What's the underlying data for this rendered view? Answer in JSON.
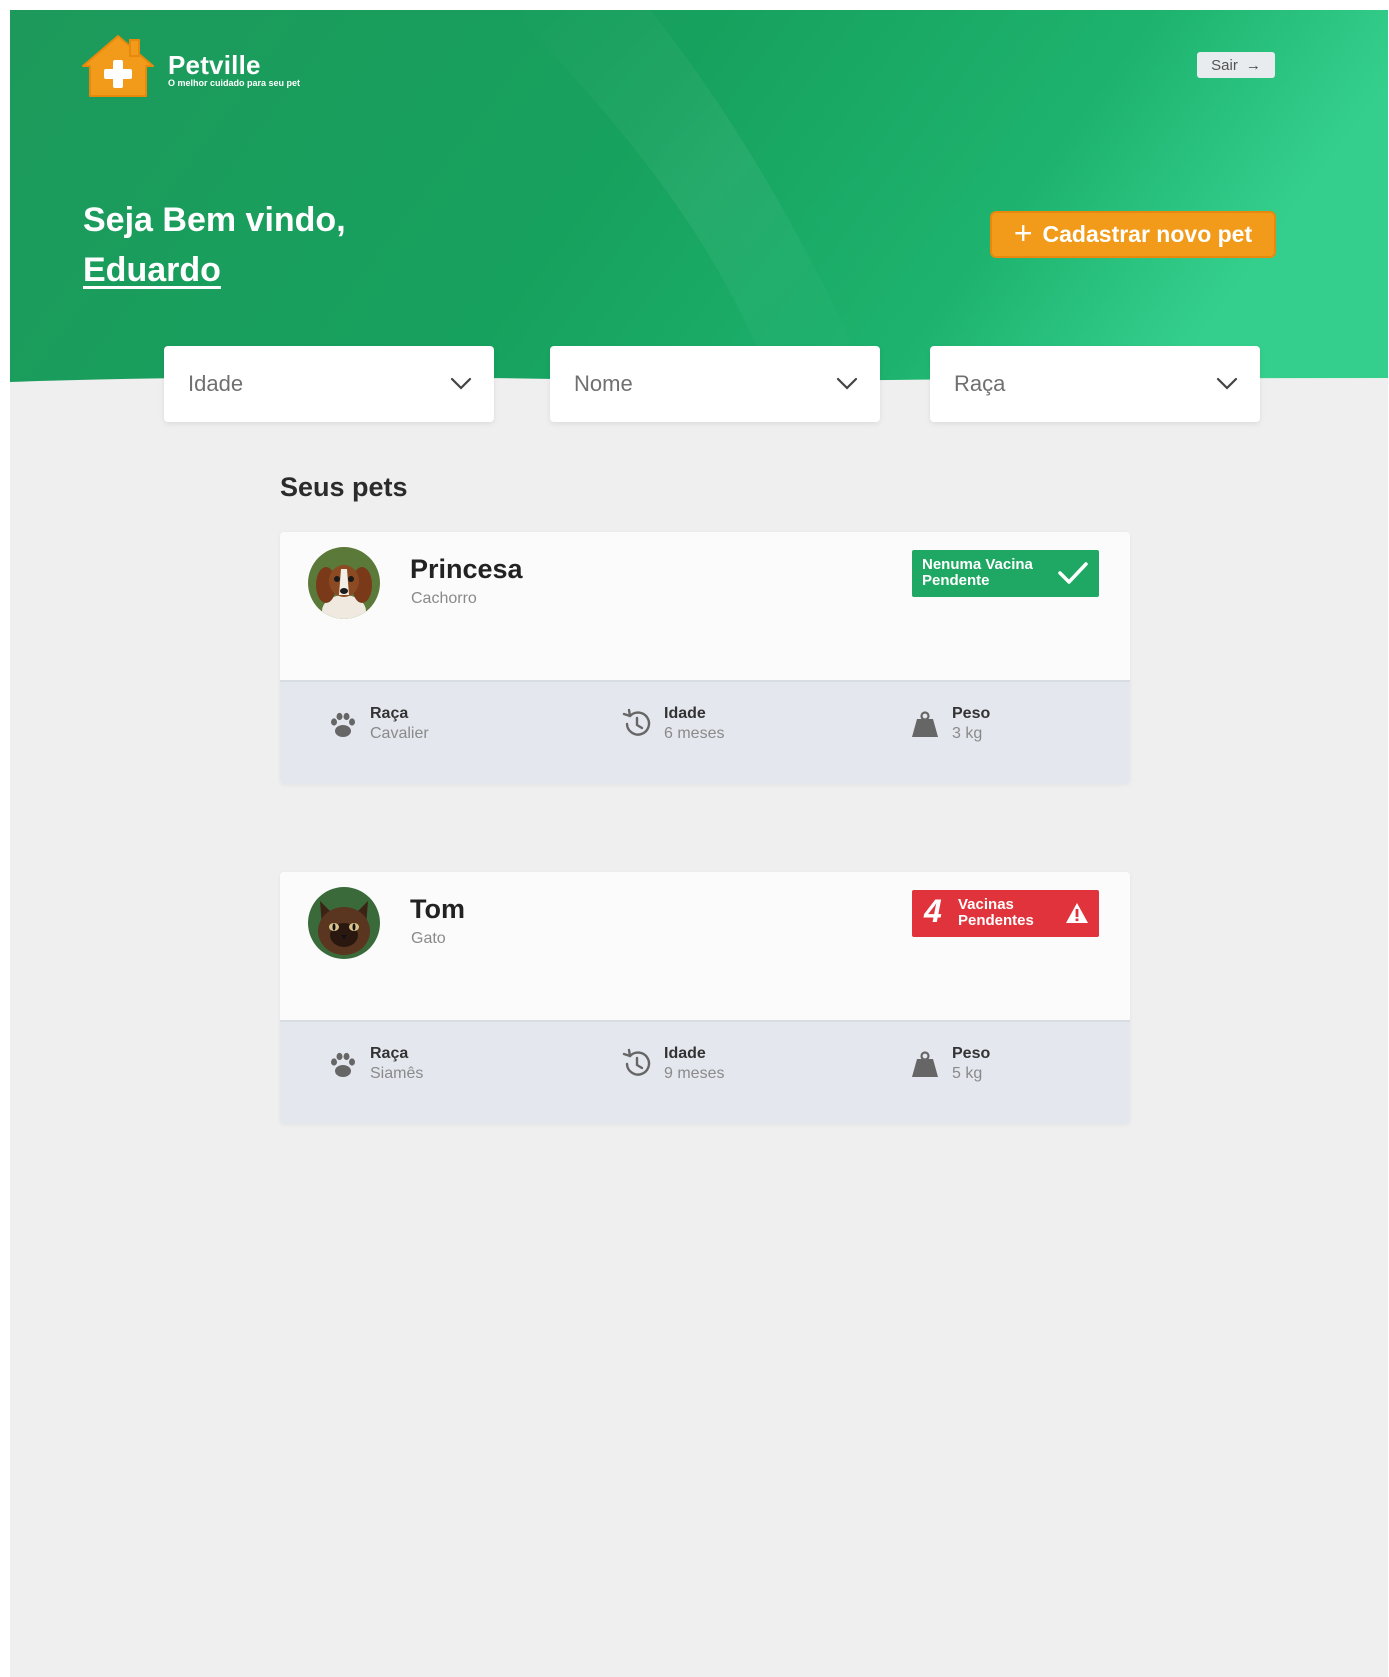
{
  "header": {
    "brand_name": "Petville",
    "brand_tagline": "O melhor cuidado para seu pet",
    "logout_label": "Sair"
  },
  "welcome": {
    "greeting": "Seja Bem vindo,",
    "user_name": "Eduardo"
  },
  "add_pet_label": "Cadastrar novo pet",
  "filters": [
    {
      "label": "Idade"
    },
    {
      "label": "Nome"
    },
    {
      "label": "Raça"
    }
  ],
  "section_title": "Seus pets",
  "pets": [
    {
      "name": "Princesa",
      "species": "Cachorro",
      "badge": {
        "status": "ok",
        "line1": "Nenuma Vacina",
        "line2": "Pendente"
      },
      "breed_label": "Raça",
      "breed": "Cavalier",
      "age_label": "Idade",
      "age": "6 meses",
      "weight_label": "Peso",
      "weight": "3 kg"
    },
    {
      "name": "Tom",
      "species": "Gato",
      "badge": {
        "status": "warning",
        "count": "4",
        "line1": "Vacinas",
        "line2": "Pendentes"
      },
      "breed_label": "Raça",
      "breed": "Siamês",
      "age_label": "Idade",
      "age": "9 meses",
      "weight_label": "Peso",
      "weight": "5 kg"
    }
  ],
  "colors": {
    "primary_green": "#1fa863",
    "accent_orange": "#f29b1a",
    "danger_red": "#e0333b",
    "background": "#efefef"
  },
  "icons": {
    "logo": "house-plus-icon",
    "logout": "arrow-right-icon",
    "add": "plus-icon",
    "filter": "chevron-down-icon",
    "breed": "paw-icon",
    "age": "history-icon",
    "weight": "weight-icon",
    "ok": "check-icon",
    "warning": "alert-triangle-icon"
  }
}
